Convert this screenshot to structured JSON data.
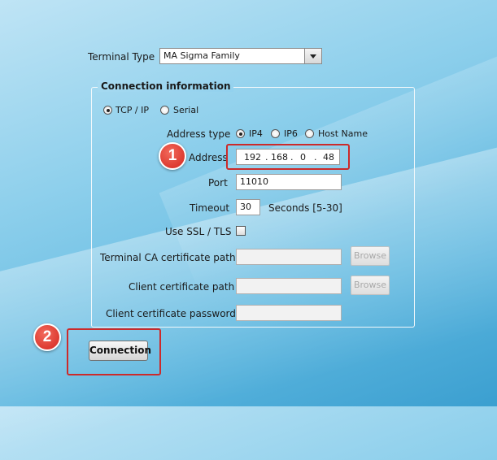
{
  "terminal_type": {
    "label": "Terminal Type",
    "selected": "MA Sigma Family"
  },
  "connection_info": {
    "title": "Connection information",
    "mode_options": {
      "tcp_ip": "TCP / IP",
      "serial": "Serial",
      "selected": "tcp_ip"
    },
    "address_type": {
      "label": "Address type",
      "options": {
        "ip4": "IP4",
        "ip6": "IP6",
        "host_name": "Host Name"
      },
      "selected": "ip4"
    },
    "address": {
      "label": "Address",
      "octets": [
        "192",
        "168",
        "0",
        "48"
      ],
      "separator": "."
    },
    "port": {
      "label": "Port",
      "value": "11010"
    },
    "timeout": {
      "label": "Timeout",
      "value": "30",
      "suffix": "Seconds [5-30]"
    },
    "use_ssl": {
      "label": "Use SSL / TLS",
      "checked": false
    },
    "terminal_ca_path": {
      "label": "Terminal CA certificate path",
      "value": "",
      "browse_label": "Browse"
    },
    "client_cert_path": {
      "label": "Client certificate path",
      "value": "",
      "browse_label": "Browse"
    },
    "client_cert_password": {
      "label": "Client certificate password",
      "value": ""
    }
  },
  "connection_button": {
    "label": "Connection"
  },
  "annotations": {
    "step1": "1",
    "step2": "2",
    "highlight_color": "#cc2a2a",
    "badge_color": "#d4261e"
  }
}
